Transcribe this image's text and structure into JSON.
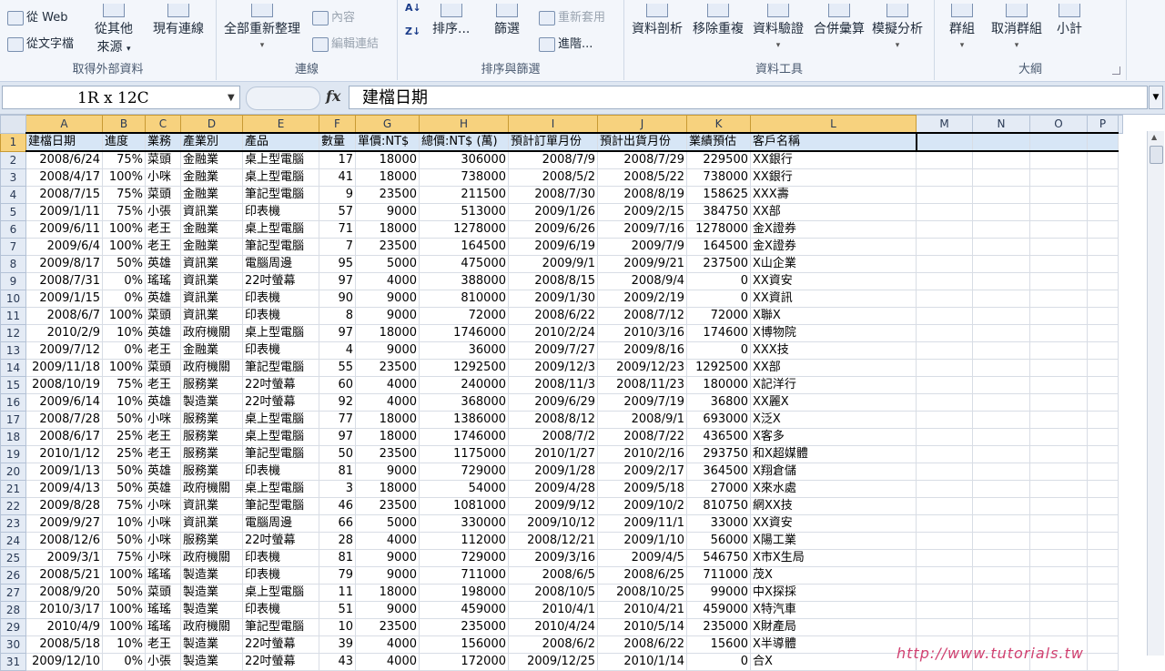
{
  "ribbon": {
    "groups": {
      "external": {
        "title": "取得外部資料",
        "from_web": "從 Web",
        "from_text": "從文字檔",
        "from_other": "從其他",
        "from_other2": "來源",
        "existing": "現有連線"
      },
      "connections": {
        "title": "連線",
        "refresh_all": "全部重新整理",
        "properties": "內容",
        "edit_links": "編輯連結"
      },
      "sort_filter": {
        "title": "排序與篩選",
        "sort_az": "Z↓",
        "sort": "排序...",
        "filter": "篩選",
        "reapply": "重新套用",
        "advanced": "進階..."
      },
      "data_tools": {
        "title": "資料工具",
        "text_to_columns": "資料剖析",
        "remove_dup": "移除重複",
        "validation": "資料驗證",
        "consolidate": "合併彙算",
        "whatif": "模擬分析"
      },
      "outline": {
        "title": "大綱",
        "group": "群組",
        "ungroup": "取消群組",
        "subtotal": "小計"
      }
    }
  },
  "formula_bar": {
    "name_box": "1R x 12C",
    "fx": "fx",
    "formula": "建檔日期"
  },
  "columns": [
    "A",
    "B",
    "C",
    "D",
    "E",
    "F",
    "G",
    "H",
    "I",
    "J",
    "K",
    "L",
    "M",
    "N",
    "O",
    "P"
  ],
  "header_row": [
    "建檔日期",
    "進度",
    "業務",
    "產業別",
    "產品",
    "數量",
    "單價:NT$",
    "總價:NT$ (萬)",
    "預計訂單月份",
    "預計出貨月份",
    "業績預估",
    "客戶名稱"
  ],
  "rows": [
    [
      "2008/6/24",
      "75%",
      "菜頭",
      "金融業",
      "桌上型電腦",
      "17",
      "18000",
      "306000",
      "2008/7/9",
      "2008/7/29",
      "229500",
      "XX銀行"
    ],
    [
      "2008/4/17",
      "100%",
      "小咪",
      "金融業",
      "桌上型電腦",
      "41",
      "18000",
      "738000",
      "2008/5/2",
      "2008/5/22",
      "738000",
      "XX銀行"
    ],
    [
      "2008/7/15",
      "75%",
      "菜頭",
      "金融業",
      "筆記型電腦",
      "9",
      "23500",
      "211500",
      "2008/7/30",
      "2008/8/19",
      "158625",
      "XXX壽"
    ],
    [
      "2009/1/11",
      "75%",
      "小張",
      "資訊業",
      "印表機",
      "57",
      "9000",
      "513000",
      "2009/1/26",
      "2009/2/15",
      "384750",
      "XX部"
    ],
    [
      "2009/6/11",
      "100%",
      "老王",
      "金融業",
      "桌上型電腦",
      "71",
      "18000",
      "1278000",
      "2009/6/26",
      "2009/7/16",
      "1278000",
      "金X證券"
    ],
    [
      "2009/6/4",
      "100%",
      "老王",
      "金融業",
      "筆記型電腦",
      "7",
      "23500",
      "164500",
      "2009/6/19",
      "2009/7/9",
      "164500",
      "金X證券"
    ],
    [
      "2009/8/17",
      "50%",
      "英雄",
      "資訊業",
      "電腦周邊",
      "95",
      "5000",
      "475000",
      "2009/9/1",
      "2009/9/21",
      "237500",
      "X山企業"
    ],
    [
      "2008/7/31",
      "0%",
      "瑤瑤",
      "資訊業",
      "22吋螢幕",
      "97",
      "4000",
      "388000",
      "2008/8/15",
      "2008/9/4",
      "0",
      "XX資安"
    ],
    [
      "2009/1/15",
      "0%",
      "英雄",
      "資訊業",
      "印表機",
      "90",
      "9000",
      "810000",
      "2009/1/30",
      "2009/2/19",
      "0",
      "XX資訊"
    ],
    [
      "2008/6/7",
      "100%",
      "菜頭",
      "資訊業",
      "印表機",
      "8",
      "9000",
      "72000",
      "2008/6/22",
      "2008/7/12",
      "72000",
      "X聯X"
    ],
    [
      "2010/2/9",
      "10%",
      "英雄",
      "政府機關",
      "桌上型電腦",
      "97",
      "18000",
      "1746000",
      "2010/2/24",
      "2010/3/16",
      "174600",
      "X博物院"
    ],
    [
      "2009/7/12",
      "0%",
      "老王",
      "金融業",
      "印表機",
      "4",
      "9000",
      "36000",
      "2009/7/27",
      "2009/8/16",
      "0",
      "XXX技"
    ],
    [
      "2009/11/18",
      "100%",
      "菜頭",
      "政府機關",
      "筆記型電腦",
      "55",
      "23500",
      "1292500",
      "2009/12/3",
      "2009/12/23",
      "1292500",
      "XX部"
    ],
    [
      "2008/10/19",
      "75%",
      "老王",
      "服務業",
      "22吋螢幕",
      "60",
      "4000",
      "240000",
      "2008/11/3",
      "2008/11/23",
      "180000",
      "X記洋行"
    ],
    [
      "2009/6/14",
      "10%",
      "英雄",
      "製造業",
      "22吋螢幕",
      "92",
      "4000",
      "368000",
      "2009/6/29",
      "2009/7/19",
      "36800",
      "XX麗X"
    ],
    [
      "2008/7/28",
      "50%",
      "小咪",
      "服務業",
      "桌上型電腦",
      "77",
      "18000",
      "1386000",
      "2008/8/12",
      "2008/9/1",
      "693000",
      "X泛X"
    ],
    [
      "2008/6/17",
      "25%",
      "老王",
      "服務業",
      "桌上型電腦",
      "97",
      "18000",
      "1746000",
      "2008/7/2",
      "2008/7/22",
      "436500",
      "X客多"
    ],
    [
      "2010/1/12",
      "25%",
      "老王",
      "服務業",
      "筆記型電腦",
      "50",
      "23500",
      "1175000",
      "2010/1/27",
      "2010/2/16",
      "293750",
      "和X超媒體"
    ],
    [
      "2009/1/13",
      "50%",
      "英雄",
      "服務業",
      "印表機",
      "81",
      "9000",
      "729000",
      "2009/1/28",
      "2009/2/17",
      "364500",
      "X翔倉儲"
    ],
    [
      "2009/4/13",
      "50%",
      "英雄",
      "政府機關",
      "桌上型電腦",
      "3",
      "18000",
      "54000",
      "2009/4/28",
      "2009/5/18",
      "27000",
      "X來水處"
    ],
    [
      "2009/8/28",
      "75%",
      "小咪",
      "資訊業",
      "筆記型電腦",
      "46",
      "23500",
      "1081000",
      "2009/9/12",
      "2009/10/2",
      "810750",
      "網XX技"
    ],
    [
      "2009/9/27",
      "10%",
      "小咪",
      "資訊業",
      "電腦周邊",
      "66",
      "5000",
      "330000",
      "2009/10/12",
      "2009/11/1",
      "33000",
      "XX資安"
    ],
    [
      "2008/12/6",
      "50%",
      "小咪",
      "服務業",
      "22吋螢幕",
      "28",
      "4000",
      "112000",
      "2008/12/21",
      "2009/1/10",
      "56000",
      "X陽工業"
    ],
    [
      "2009/3/1",
      "75%",
      "小咪",
      "政府機關",
      "印表機",
      "81",
      "9000",
      "729000",
      "2009/3/16",
      "2009/4/5",
      "546750",
      "X市X生局"
    ],
    [
      "2008/5/21",
      "100%",
      "瑤瑤",
      "製造業",
      "印表機",
      "79",
      "9000",
      "711000",
      "2008/6/5",
      "2008/6/25",
      "711000",
      "茂X"
    ],
    [
      "2008/9/20",
      "50%",
      "菜頭",
      "製造業",
      "桌上型電腦",
      "11",
      "18000",
      "198000",
      "2008/10/5",
      "2008/10/25",
      "99000",
      "中X探採"
    ],
    [
      "2010/3/17",
      "100%",
      "瑤瑤",
      "製造業",
      "印表機",
      "51",
      "9000",
      "459000",
      "2010/4/1",
      "2010/4/21",
      "459000",
      "X特汽車"
    ],
    [
      "2010/4/9",
      "100%",
      "瑤瑤",
      "政府機關",
      "筆記型電腦",
      "10",
      "23500",
      "235000",
      "2010/4/24",
      "2010/5/14",
      "235000",
      "X財產局"
    ],
    [
      "2008/5/18",
      "10%",
      "老王",
      "製造業",
      "22吋螢幕",
      "39",
      "4000",
      "156000",
      "2008/6/2",
      "2008/6/22",
      "15600",
      "X半導體"
    ],
    [
      "2009/12/10",
      "0%",
      "小張",
      "製造業",
      "22吋螢幕",
      "43",
      "4000",
      "172000",
      "2009/12/25",
      "2010/1/14",
      "0",
      "合X"
    ]
  ],
  "watermark": "http://www.tutorials.tw"
}
